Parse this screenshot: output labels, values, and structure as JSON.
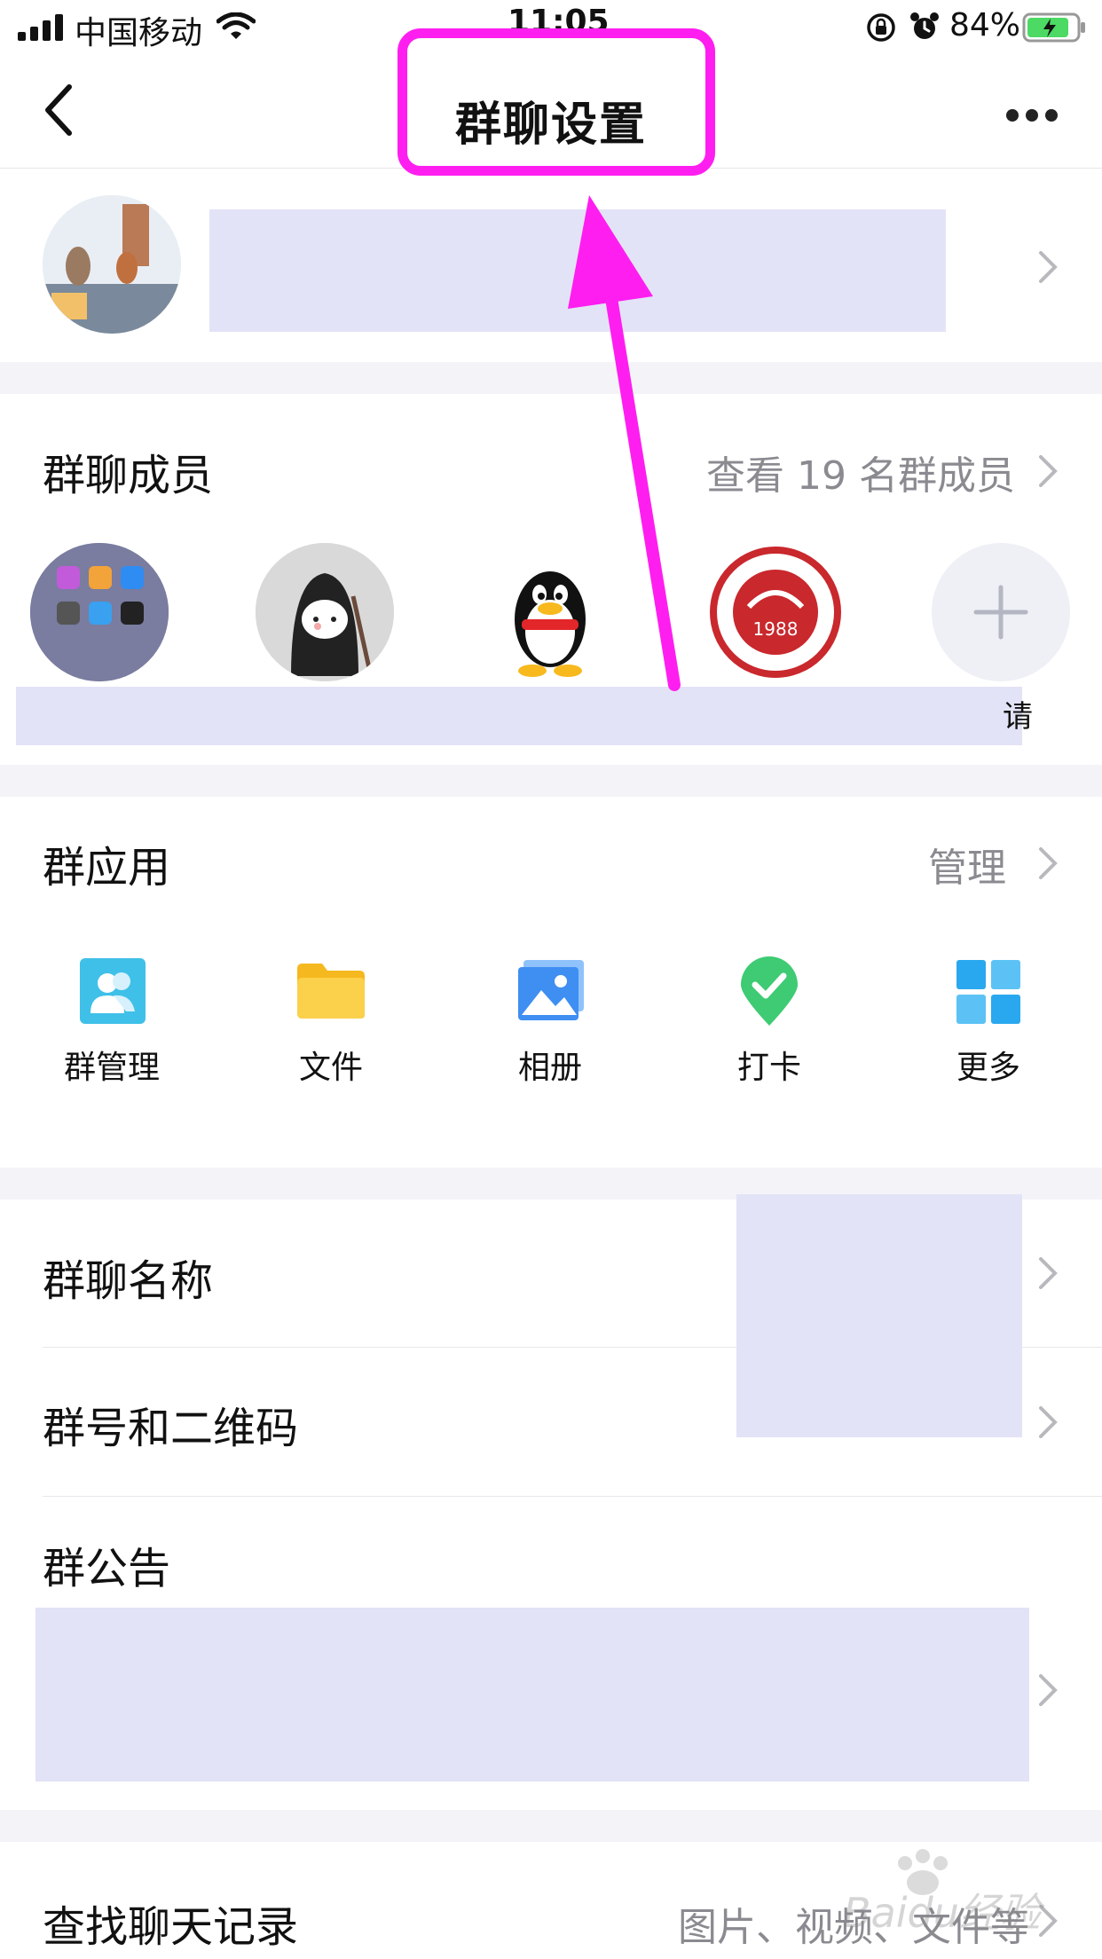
{
  "status_bar": {
    "carrier": "中国移动",
    "time": "11:05",
    "battery": "84%"
  },
  "nav": {
    "title": "群聊设置"
  },
  "members": {
    "title": "群聊成员",
    "view_all": "查看 19 名群成员",
    "partial_label": "请"
  },
  "apps": {
    "title": "群应用",
    "manage": "管理",
    "items": [
      {
        "label": "群管理",
        "icon": "group-manage-icon",
        "color": "#3fc0e8"
      },
      {
        "label": "文件",
        "icon": "folder-icon",
        "color": "#fbc52d"
      },
      {
        "label": "相册",
        "icon": "album-icon",
        "color": "#3f8ef2"
      },
      {
        "label": "打卡",
        "icon": "checkin-icon",
        "color": "#3ecb73"
      },
      {
        "label": "更多",
        "icon": "more-grid-icon",
        "color": "#2aa8ef"
      }
    ]
  },
  "settings": {
    "group_name": "群聊名称",
    "group_id_qr": "群号和二维码",
    "announcement": "群公告",
    "search_history": "查找聊天记录",
    "search_history_hint": "图片、视频、文件等"
  },
  "annotation": {
    "color": "#ff1ef0"
  },
  "watermark": {
    "text": "Baidu经验"
  }
}
